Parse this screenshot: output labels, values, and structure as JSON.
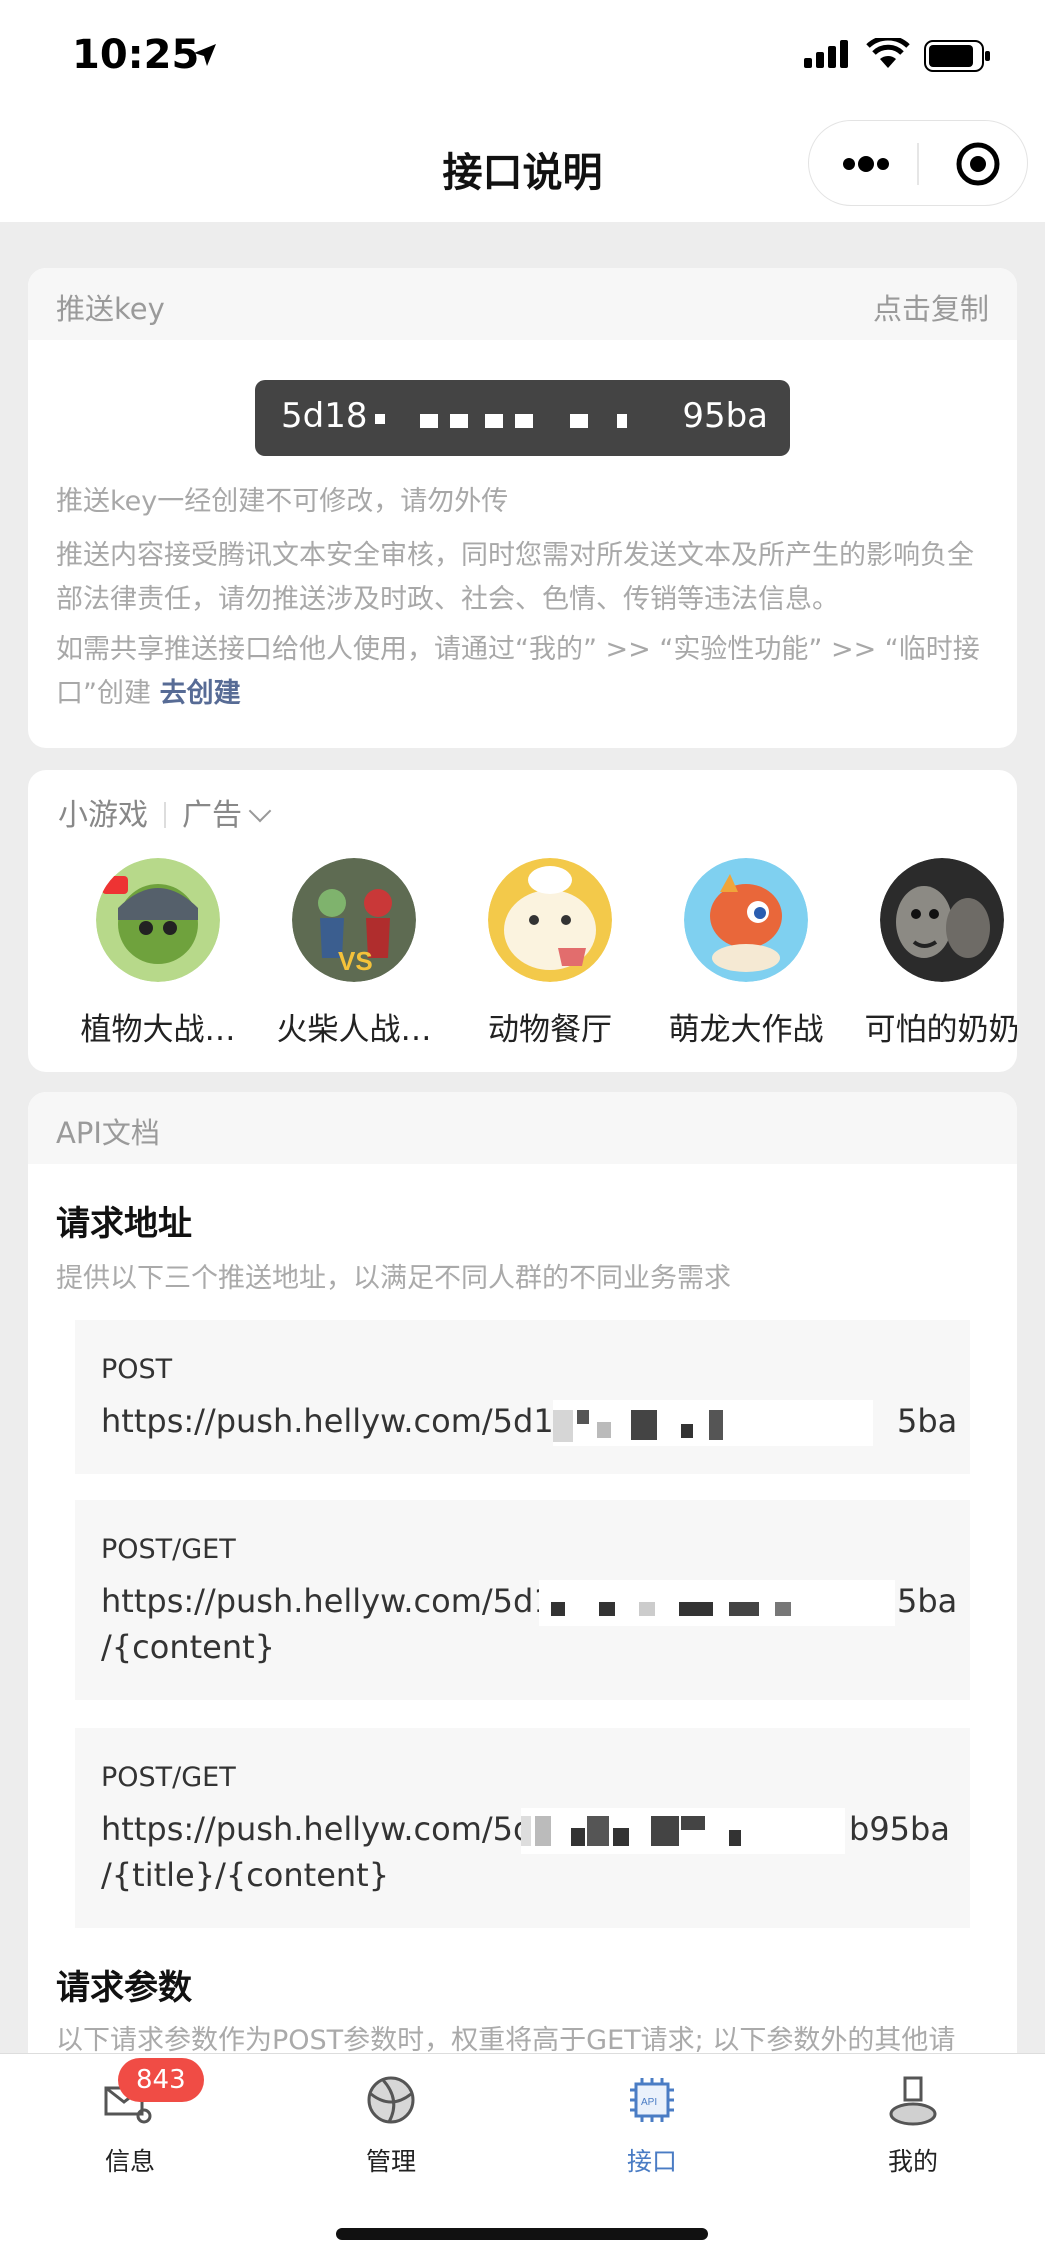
{
  "status": {
    "time": "10:25"
  },
  "nav": {
    "title": "接口说明"
  },
  "key_card": {
    "header_left": "推送key",
    "header_right": "点击复制",
    "key_prefix": "5d18",
    "key_suffix": "95ba",
    "note_1": "推送key一经创建不可修改，请勿外传",
    "note_2": "推送内容接受腾讯文本安全审核，同时您需对所发送文本及所产生的影响负全部法律责任，请勿推送涉及时政、社会、色情、传销等违法信息。",
    "note_3": "如需共享推送接口给他人使用，请通过“我的” >> “实验性功能” >> “临时接口”创建",
    "create_link": "去创建"
  },
  "games": {
    "label": "小游戏",
    "ad_label": "广告",
    "items": [
      {
        "name": "植物大战…",
        "icon": "plants-game-icon",
        "color": "#6fa23d"
      },
      {
        "name": "火柴人战…",
        "icon": "stickman-game-icon",
        "color": "#5e6b52"
      },
      {
        "name": "动物餐厅",
        "icon": "animal-restaurant-icon",
        "color": "#f3c94a"
      },
      {
        "name": "萌龙大作战",
        "icon": "dragon-game-icon",
        "color": "#4fb7e8"
      },
      {
        "name": "可怕的奶奶",
        "icon": "granny-game-icon",
        "color": "#3a3a3a"
      }
    ]
  },
  "api": {
    "header": "API文档",
    "request_title": "请求地址",
    "request_desc": "提供以下三个推送地址，以满足不同人群的不同业务需求",
    "addresses": [
      {
        "method": "POST",
        "url": "https://push.hellyw.com/5d188",
        "url_end": "5ba",
        "line2": ""
      },
      {
        "method": "POST/GET",
        "url": "https://push.hellyw.com/5d18",
        "url_end": "5ba",
        "line2": "/{content}"
      },
      {
        "method": "POST/GET",
        "url": "https://push.hellyw.com/5d1",
        "url_end": "b95ba",
        "line2": "/{title}/{content}"
      }
    ],
    "params_title": "请求参数",
    "params_desc": "以下请求参数作为POST参数时，权重将高于GET请求; 以下参数外的其他请"
  },
  "tabbar": {
    "badge": "843",
    "tabs": [
      {
        "label": "信息"
      },
      {
        "label": "管理"
      },
      {
        "label": "接口"
      },
      {
        "label": "我的"
      }
    ]
  }
}
